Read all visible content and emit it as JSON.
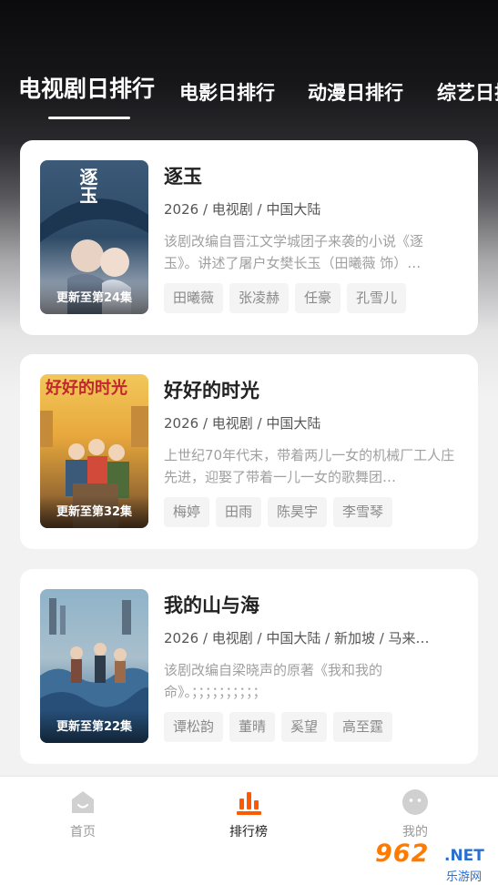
{
  "tabs": [
    {
      "label": "电视剧日排行",
      "active": true
    },
    {
      "label": "电影日排行",
      "active": false
    },
    {
      "label": "动漫日排行",
      "active": false
    },
    {
      "label": "综艺日排行",
      "active": false
    }
  ],
  "cards": [
    {
      "title": "逐玉",
      "meta": "2026 / 电视剧 / 中国大陆",
      "desc": "该剧改编自晋江文学城团子来袭的小说《逐玉》。讲述了屠户女樊长玉（田曦薇 饰）…",
      "badge": "更新至第24集",
      "poster_title": "逐玉",
      "tags": [
        "田曦薇",
        "张凌赫",
        "任豪",
        "孔雪儿"
      ]
    },
    {
      "title": "好好的时光",
      "meta": "2026 / 电视剧 / 中国大陆",
      "desc": "上世纪70年代末，带着两儿一女的机械厂工人庄先进，迎娶了带着一儿一女的歌舞团…",
      "badge": "更新至第32集",
      "poster_title": "好好的时光",
      "tags": [
        "梅婷",
        "田雨",
        "陈昊宇",
        "李雪琴"
      ]
    },
    {
      "title": "我的山与海",
      "meta": "2026 / 电视剧 / 中国大陆 / 新加坡 / 马来…",
      "desc": "该剧改编自梁晓声的原著《我和我的命》。；；；；；；；；；；",
      "badge": "更新至第22集",
      "poster_title": "",
      "tags": [
        "谭松韵",
        "董晴",
        "奚望",
        "高至霆"
      ]
    }
  ],
  "bottom_nav": [
    {
      "label": "首页",
      "icon": "home-icon",
      "active": false
    },
    {
      "label": "排行榜",
      "icon": "ranking-icon",
      "active": true
    },
    {
      "label": "我的",
      "icon": "profile-icon",
      "active": false
    }
  ],
  "watermark": {
    "main": "962",
    "net": ".NET",
    "sub": "乐游网"
  },
  "colors": {
    "accent": "#ff5a00",
    "card_bg": "#ffffff",
    "tag_bg": "#f4f4f4"
  }
}
